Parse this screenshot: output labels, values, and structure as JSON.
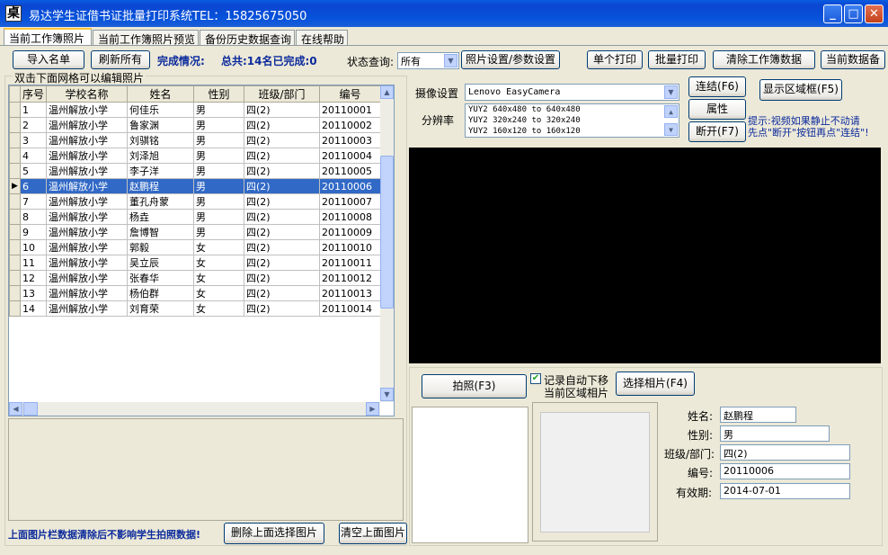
{
  "window": {
    "title": "易达学生证借书证批量打印系统TEL：15825675050",
    "app_icon_glyph": "桌"
  },
  "tabs": [
    {
      "label": "当前工作簿照片"
    },
    {
      "label": "当前工作簿照片预览"
    },
    {
      "label": "备份历史数据查询"
    },
    {
      "label": "在线帮助"
    }
  ],
  "toolbar": {
    "import_label": "导入名单",
    "refresh_label": "刷新所有",
    "status_title": "完成情况:",
    "status_summary": "总共:14名已完成:0",
    "filter_label": "状态查询:",
    "filter_value": "所有",
    "photo_settings_label": "照片设置/参数设置",
    "single_print_label": "单个打印",
    "batch_print_label": "批量打印",
    "clear_workbook_label": "清除工作簿数据",
    "backup_label": "当前数据备"
  },
  "grid": {
    "caption": "双击下面网格可以编辑照片",
    "columns": [
      "序号",
      "学校名称",
      "姓名",
      "性别",
      "班级/部门",
      "编号"
    ],
    "rows": [
      [
        "1",
        "温州解放小学",
        "何佳乐",
        "男",
        "四(2)",
        "20110001"
      ],
      [
        "2",
        "温州解放小学",
        "鲁家渊",
        "男",
        "四(2)",
        "20110002"
      ],
      [
        "3",
        "温州解放小学",
        "刘骐铭",
        "男",
        "四(2)",
        "20110003"
      ],
      [
        "4",
        "温州解放小学",
        "刘泽旭",
        "男",
        "四(2)",
        "20110004"
      ],
      [
        "5",
        "温州解放小学",
        "李子洋",
        "男",
        "四(2)",
        "20110005"
      ],
      [
        "6",
        "温州解放小学",
        "赵鹏程",
        "男",
        "四(2)",
        "20110006"
      ],
      [
        "7",
        "温州解放小学",
        "董孔舟蒙",
        "男",
        "四(2)",
        "20110007"
      ],
      [
        "8",
        "温州解放小学",
        "杨垚",
        "男",
        "四(2)",
        "20110008"
      ],
      [
        "9",
        "温州解放小学",
        "詹博智",
        "男",
        "四(2)",
        "20110009"
      ],
      [
        "10",
        "温州解放小学",
        "郭毅",
        "女",
        "四(2)",
        "20110010"
      ],
      [
        "11",
        "温州解放小学",
        "吴立辰",
        "女",
        "四(2)",
        "20110011"
      ],
      [
        "12",
        "温州解放小学",
        "张春华",
        "女",
        "四(2)",
        "20110012"
      ],
      [
        "13",
        "温州解放小学",
        "杨伯群",
        "女",
        "四(2)",
        "20110013"
      ],
      [
        "14",
        "温州解放小学",
        "刘育荣",
        "女",
        "四(2)",
        "20110014"
      ]
    ],
    "selected_index": 5
  },
  "bottom_left": {
    "note": "上面图片栏数据清除后不影响学生拍照数据!",
    "delete_selected_label": "删除上面选择图片",
    "clear_above_label": "清空上面图片"
  },
  "camera": {
    "device_label": "摄像设置",
    "device_value": "Lenovo EasyCamera",
    "resolution_label": "分辨率",
    "resolutions": [
      "YUY2 640x480 to 640x480",
      "YUY2 320x240 to 320x240",
      "YUY2 160x120 to 160x120"
    ],
    "connect_label": "连结(F6)",
    "properties_label": "属性",
    "disconnect_label": "断开(F7)",
    "show_area_label": "显示区域框(F5)",
    "hint_line1": "提示:视频如果静止不动请",
    "hint_line2": "先点\"断开\"按钮再点\"连结\"!"
  },
  "capture": {
    "shoot_label": "拍照(F3)",
    "auto_move_label": "记录自动下移",
    "current_area_label": "当前区域相片",
    "select_photo_label": "选择相片(F4)",
    "auto_move_checked": true
  },
  "student": {
    "name_label": "姓名:",
    "name_value": "赵鹏程",
    "gender_label": "性别:",
    "gender_value": "男",
    "class_label": "班级/部门:",
    "class_value": "四(2)",
    "id_label": "编号:",
    "id_value": "20110006",
    "expiry_label": "有效期:",
    "expiry_value": "2014-07-01"
  },
  "colors": {
    "titlebar": "#0a46d2",
    "selection": "#3169c6",
    "status_text": "#0b2a9c",
    "hint_text": "#0b2a9c"
  }
}
